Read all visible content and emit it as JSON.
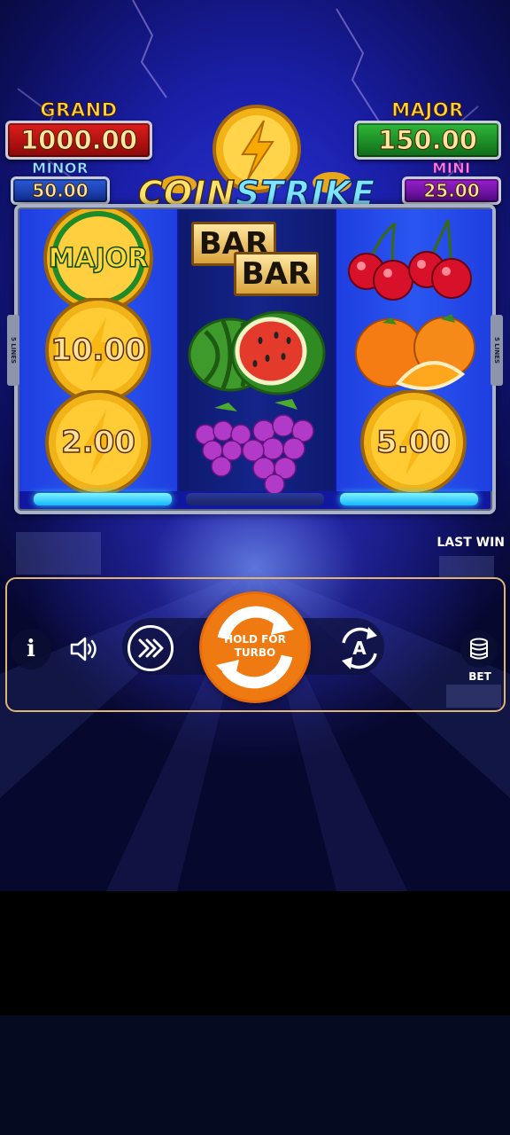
{
  "jackpots": {
    "grand": {
      "label": "GRAND",
      "value": "1000.00"
    },
    "major": {
      "label": "MAJOR",
      "value": "150.00"
    },
    "minor": {
      "label": "MINOR",
      "value": "50.00"
    },
    "mini": {
      "label": "MINI",
      "value": "25.00"
    }
  },
  "logo": {
    "word1": "COIN",
    "word2": "STRIKE"
  },
  "reels": {
    "reel1": {
      "top_label": "MAJOR",
      "mid_value": "10.00",
      "bottom_value": "2.00"
    },
    "reel2": {
      "bar_top": "BAR",
      "bar_bottom": "BAR"
    },
    "reel3": {
      "bottom_value": "5.00"
    },
    "lines_label": "5 LINES"
  },
  "info": {
    "last_win_label": "LAST WIN"
  },
  "controls": {
    "info_label": "i",
    "spin_label": "HOLD FOR TURBO",
    "auto_label": "A",
    "bet_label": "BET"
  },
  "colors": {
    "spin_button": "#f07a12",
    "panel_border": "#e0b473",
    "reel_glow": "#35d0ff"
  }
}
